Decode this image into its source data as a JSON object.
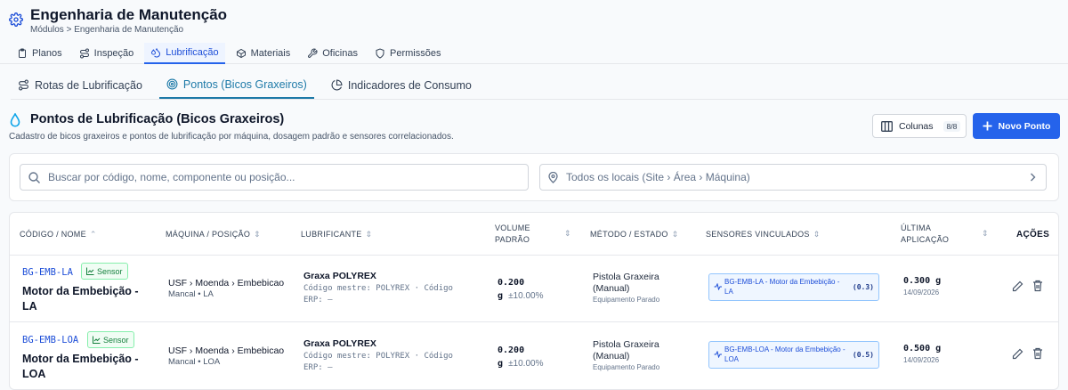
{
  "header": {
    "title": "Engenharia de Manutenção",
    "breadcrumb": [
      "Módulos",
      ">",
      "Engenharia de Manutenção"
    ]
  },
  "module_tabs": [
    {
      "label": "Planos",
      "icon": "clipboard-icon",
      "active": false
    },
    {
      "label": "Inspeção",
      "icon": "route-icon",
      "active": false
    },
    {
      "label": "Lubrificação",
      "icon": "droplets-icon",
      "active": true
    },
    {
      "label": "Materiais",
      "icon": "box-icon",
      "active": false
    },
    {
      "label": "Oficinas",
      "icon": "wrench-icon",
      "active": false
    },
    {
      "label": "Permissões",
      "icon": "shield-icon",
      "active": false
    }
  ],
  "sub_tabs": [
    {
      "label": "Rotas de Lubrificação",
      "icon": "route-icon",
      "active": false
    },
    {
      "label": "Pontos (Bicos Graxeiros)",
      "icon": "target-icon",
      "active": true
    },
    {
      "label": "Indicadores de Consumo",
      "icon": "pie-chart-icon",
      "active": false
    }
  ],
  "section": {
    "title": "Pontos de Lubrificação (Bicos Graxeiros)",
    "subtitle": "Cadastro de bicos graxeiros e pontos de lubrificação por máquina, dosagem padrão e sensores correlacionados.",
    "columns_button": "Colunas",
    "columns_count": "8/8",
    "new_button": "Novo Ponto"
  },
  "filters": {
    "search_placeholder": "Buscar por código, nome, componente ou posição...",
    "location_placeholder": "Todos os locais (Site › Área › Máquina)"
  },
  "table": {
    "headers": {
      "code": "Código / Nome",
      "machine": "Máquina / Posição",
      "lubricant": "Lubrificante",
      "volume_1": "Volume",
      "volume_2": "Padrão",
      "method": "Método / Estado",
      "sensors": "Sensores Vinculados",
      "last_1": "Última",
      "last_2": "Aplicação",
      "actions": "Ações"
    },
    "rows": [
      {
        "code": "BG-EMB-LA",
        "badge": "Sensor",
        "name_1": "Motor da Embebição -",
        "name_2": "LA",
        "machine": "USF › Moenda › Embebicao",
        "position": "Mancal • LA",
        "lubricant": "Graxa POLYREX",
        "lub_detail_1": "Código mestre: POLYREX · Código",
        "lub_detail_2": "ERP: —",
        "volume": "0.200",
        "unit": "g",
        "tolerance": "±10.00%",
        "method_1": "Pistola Graxeira",
        "method_2": "(Manual)",
        "state": "Equipamento Parado",
        "sensor_label": "BG-EMB-LA - Motor da Embebição - LA",
        "sensor_value": "(0.3)",
        "last_value": "0.300 g",
        "last_date": "14/09/2026"
      },
      {
        "code": "BG-EMB-LOA",
        "badge": "Sensor",
        "name_1": "Motor da Embebição -",
        "name_2": "LOA",
        "machine": "USF › Moenda › Embebicao",
        "position": "Mancal • LOA",
        "lubricant": "Graxa POLYREX",
        "lub_detail_1": "Código mestre: POLYREX · Código",
        "lub_detail_2": "ERP: —",
        "volume": "0.200",
        "unit": "g",
        "tolerance": "±10.00%",
        "method_1": "Pistola Graxeira",
        "method_2": "(Manual)",
        "state": "Equipamento Parado",
        "sensor_label": "BG-EMB-LOA - Motor da Embebição - LOA",
        "sensor_value": "(0.5)",
        "last_value": "0.500 g",
        "last_date": "14/09/2026"
      }
    ]
  },
  "colors": {
    "primary": "#2563eb",
    "accent_tab": "#1e7aa8",
    "sensor_badge": "#15803d"
  }
}
